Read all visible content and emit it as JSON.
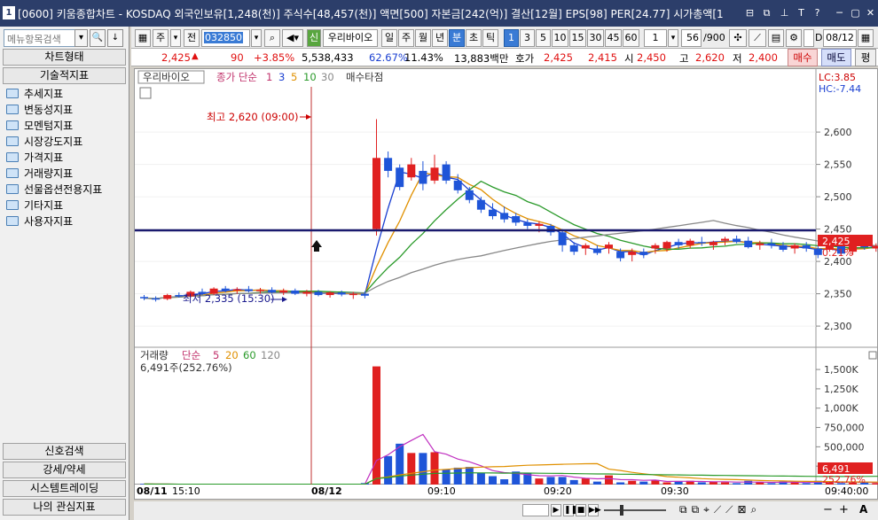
{
  "window": {
    "number": "1",
    "title": "[0600] 키움종합차트 - KOSDAQ 외국인보유[1,248(천)] 주식수[48,457(천)] 액면[500] 자본금[242(억)] 결산[12월] EPS[98] PER[24.77] 시가총액[1",
    "buttons": [
      "⊟",
      "⧉",
      "⊥",
      "T",
      "?",
      "─",
      "▢",
      "✕"
    ]
  },
  "left_panel": {
    "search_placeholder": "메뉴항목검색",
    "search_buttons": [
      "▾",
      "🔍",
      "↓"
    ],
    "headers": [
      "차트형태",
      "기술적지표"
    ],
    "tree_items": [
      "추세지표",
      "변동성지표",
      "모멘텀지표",
      "시장강도지표",
      "가격지표",
      "거래량지표",
      "선물옵션전용지표",
      "기타지표",
      "사용자지표"
    ],
    "bottom_buttons": [
      "신호검색",
      "강세/약세",
      "시스템트레이딩",
      "나의 관심지표"
    ]
  },
  "toolbar": {
    "period_unit": "주",
    "prev_label": "전",
    "code_value": "032850",
    "stock_name": "우리바이오",
    "period_tabs": [
      "일",
      "주",
      "월",
      "년",
      "분",
      "초",
      "틱"
    ],
    "active_tab": "분",
    "minute_options": [
      "1",
      "3",
      "5",
      "10",
      "15",
      "30",
      "45",
      "60"
    ],
    "active_minute": "1",
    "multiplier": "1",
    "count": "56",
    "count_total": "/900",
    "date_value": "08/12",
    "d_label": "D"
  },
  "info": {
    "price": "2,425",
    "change_arrow": "▲",
    "change": "90",
    "change_pct": "+3.85%",
    "volume": "5,538,433",
    "ratio1": "62.67%",
    "ratio2": "11.43%",
    "amount": "13,883백만",
    "hoga_label": "호가",
    "ask": "2,425",
    "bid": "2,415",
    "open_label": "시",
    "open": "2,450",
    "high_label": "고",
    "high": "2,620",
    "low_label": "저",
    "low": "2,400",
    "buy_button": "매수",
    "sell_button": "매도",
    "eval_button": "평"
  },
  "price_chart": {
    "legend_name": "우리바이오",
    "legend_ma_label": "종가 단순",
    "legend_ma": [
      "1",
      "3",
      "5",
      "10",
      "30"
    ],
    "legend_extra": "매수타점",
    "lc": "LC:3.85",
    "hc": "HC:-7.44",
    "high_annotation": "최고 2,620 (09:00)",
    "low_annotation": "최저 2,335 (15:30)",
    "current_price_tag": "2,425",
    "current_pct_tag": "0.21%"
  },
  "volume_chart": {
    "legend_name": "거래량",
    "legend_ma_label": "단순",
    "legend_ma": [
      "5",
      "20",
      "60",
      "120"
    ],
    "value_line": "6,491주(252.76%)",
    "current_tag": "6,491",
    "current_pct_tag": "252.76%"
  },
  "time_axis": {
    "labels": [
      "08/11",
      "15:10",
      "08/12",
      "09:10",
      "09:20",
      "09:30",
      "09:40:00"
    ]
  },
  "chart_data": {
    "type": "candlestick",
    "title": "",
    "price_axis": {
      "ticks": [
        2300,
        2350,
        2400,
        2450,
        2500,
        2550,
        2600
      ],
      "ylim": [
        2270,
        2670
      ]
    },
    "volume_axis": {
      "ticks": [
        "250,000",
        "500,000",
        "750,000",
        "1,000K",
        "1,250K",
        "1,500K"
      ],
      "ylim": [
        0,
        1650000
      ]
    },
    "horizontal_line": 2448,
    "candles": [
      [
        2345,
        2348,
        2340,
        2343
      ],
      [
        2343,
        2346,
        2338,
        2342
      ],
      [
        2342,
        2350,
        2340,
        2348
      ],
      [
        2348,
        2352,
        2344,
        2346
      ],
      [
        2346,
        2355,
        2344,
        2353
      ],
      [
        2353,
        2358,
        2348,
        2350
      ],
      [
        2350,
        2360,
        2348,
        2358
      ],
      [
        2358,
        2362,
        2352,
        2355
      ],
      [
        2355,
        2360,
        2350,
        2357
      ],
      [
        2357,
        2362,
        2352,
        2354
      ],
      [
        2354,
        2359,
        2350,
        2356
      ],
      [
        2356,
        2360,
        2350,
        2352
      ],
      [
        2352,
        2358,
        2348,
        2355
      ],
      [
        2355,
        2358,
        2348,
        2350
      ],
      [
        2350,
        2356,
        2346,
        2353
      ],
      [
        2353,
        2356,
        2346,
        2348
      ],
      [
        2348,
        2354,
        2344,
        2352
      ],
      [
        2352,
        2355,
        2346,
        2349
      ],
      [
        2349,
        2353,
        2342,
        2350
      ],
      [
        2350,
        2354,
        2343,
        2347
      ],
      [
        2450,
        2620,
        2440,
        2560
      ],
      [
        2560,
        2570,
        2530,
        2540
      ],
      [
        2545,
        2550,
        2510,
        2515
      ],
      [
        2530,
        2560,
        2525,
        2550
      ],
      [
        2540,
        2555,
        2510,
        2520
      ],
      [
        2525,
        2565,
        2520,
        2545
      ],
      [
        2550,
        2555,
        2520,
        2525
      ],
      [
        2525,
        2535,
        2505,
        2510
      ],
      [
        2510,
        2515,
        2490,
        2495
      ],
      [
        2495,
        2500,
        2475,
        2480
      ],
      [
        2480,
        2490,
        2465,
        2470
      ],
      [
        2475,
        2485,
        2460,
        2465
      ],
      [
        2470,
        2475,
        2455,
        2460
      ],
      [
        2460,
        2465,
        2450,
        2455
      ],
      [
        2455,
        2462,
        2445,
        2458
      ],
      [
        2455,
        2458,
        2440,
        2445
      ],
      [
        2445,
        2450,
        2415,
        2425
      ],
      [
        2425,
        2430,
        2410,
        2415
      ],
      [
        2420,
        2428,
        2410,
        2425
      ],
      [
        2420,
        2425,
        2410,
        2413
      ],
      [
        2420,
        2430,
        2412,
        2426
      ],
      [
        2415,
        2420,
        2400,
        2405
      ],
      [
        2410,
        2420,
        2400,
        2415
      ],
      [
        2415,
        2420,
        2405,
        2410
      ],
      [
        2420,
        2428,
        2412,
        2425
      ],
      [
        2420,
        2432,
        2415,
        2430
      ],
      [
        2430,
        2435,
        2420,
        2425
      ],
      [
        2425,
        2435,
        2420,
        2432
      ],
      [
        2430,
        2438,
        2424,
        2428
      ],
      [
        2425,
        2432,
        2418,
        2430
      ],
      [
        2432,
        2438,
        2425,
        2435
      ],
      [
        2435,
        2440,
        2428,
        2430
      ],
      [
        2432,
        2438,
        2420,
        2422
      ],
      [
        2425,
        2432,
        2418,
        2428
      ],
      [
        2428,
        2435,
        2420,
        2425
      ],
      [
        2425,
        2430,
        2415,
        2418
      ],
      [
        2420,
        2428,
        2412,
        2425
      ],
      [
        2425,
        2430,
        2415,
        2420
      ],
      [
        2420,
        2425,
        2405,
        2410
      ],
      [
        2418,
        2430,
        2415,
        2428
      ],
      [
        2428,
        2432,
        2410,
        2412
      ],
      [
        2415,
        2428,
        2410,
        2425
      ],
      [
        2425,
        2430,
        2418,
        2422
      ],
      [
        2420,
        2428,
        2415,
        2424
      ],
      [
        2426,
        2430,
        2418,
        2420
      ]
    ],
    "volumes": [
      20000,
      15000,
      18000,
      12000,
      16000,
      14000,
      20000,
      15000,
      17000,
      13000,
      18000,
      15000,
      16000,
      14000,
      17000,
      12000,
      15000,
      14000,
      16000,
      30000,
      1540000,
      380000,
      540000,
      420000,
      420000,
      430000,
      210000,
      230000,
      240000,
      160000,
      120000,
      80000,
      180000,
      160000,
      90000,
      110000,
      110000,
      70000,
      90000,
      50000,
      130000,
      40000,
      60000,
      50000,
      70000,
      40000,
      50000,
      60000,
      40000,
      50000,
      40000,
      30000,
      60000,
      40000,
      30000,
      50000,
      40000,
      30000,
      60000,
      40000,
      30000,
      50000,
      40000,
      30000,
      40000
    ]
  }
}
